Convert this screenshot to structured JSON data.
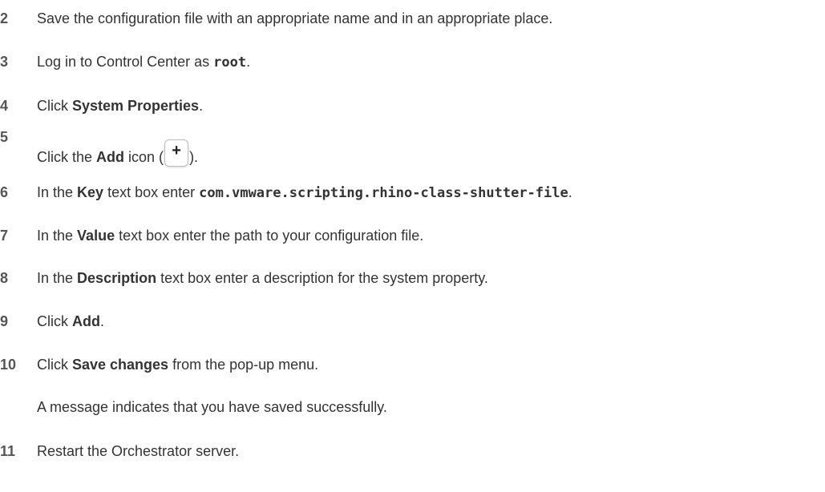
{
  "steps": [
    {
      "num": "2",
      "text": "Save the configuration file with an appropriate name and in an appropriate place."
    },
    {
      "num": "3",
      "pre": "Log in to Control Center as ",
      "code": "root",
      "post": "."
    },
    {
      "num": "4",
      "pre": "Click ",
      "bold": "System Properties",
      "post": "."
    },
    {
      "num": "5",
      "pre": "Click the ",
      "bold": "Add",
      "mid": " icon (",
      "icon_glyph": "+",
      "post": ")."
    },
    {
      "num": "6",
      "pre": "In the ",
      "bold": "Key",
      "mid": " text box enter ",
      "code": "com.vmware.scripting.rhino-class-shutter-file",
      "post": "."
    },
    {
      "num": "7",
      "pre": "In the ",
      "bold": "Value",
      "post": " text box enter the path to your configuration file."
    },
    {
      "num": "8",
      "pre": "In the ",
      "bold": "Description",
      "post": " text box enter a description for the system property."
    },
    {
      "num": "9",
      "pre": "Click ",
      "bold": "Add",
      "post": "."
    },
    {
      "num": "10",
      "pre": "Click ",
      "bold": "Save changes",
      "post": " from the pop-up menu."
    },
    {
      "num": "11",
      "text": "Restart the Orchestrator server."
    }
  ],
  "note": "A message indicates that you have saved successfully.",
  "icons": {
    "add": "plus-icon"
  }
}
